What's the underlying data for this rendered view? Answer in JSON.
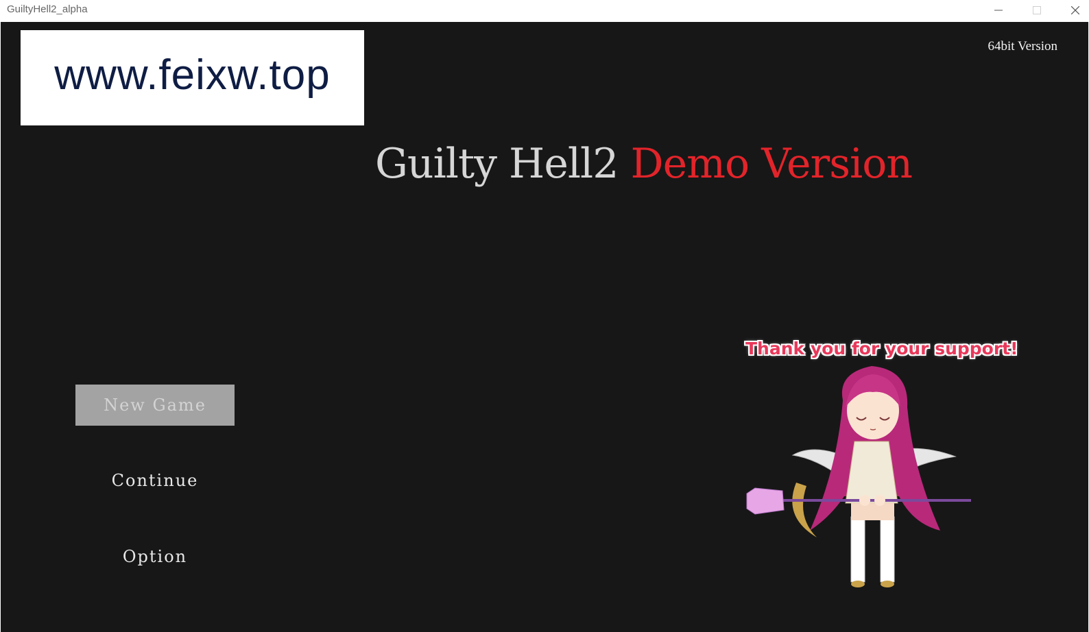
{
  "window": {
    "title": "GuiltyHell2_alpha"
  },
  "logo": {
    "text": "www.feixw.top"
  },
  "version_label": "64bit Version",
  "game_title": {
    "main": "Guilty Hell2",
    "suffix": "Demo Version"
  },
  "menu": {
    "items": [
      {
        "label": "New Game",
        "selected": true
      },
      {
        "label": "Continue",
        "selected": false
      },
      {
        "label": "Option",
        "selected": false
      }
    ]
  },
  "support_message": "Thank you for your support!",
  "colors": {
    "background": "#171717",
    "title_main": "#d6d6d6",
    "title_accent": "#e2242a",
    "menu_selected_bg": "#a3a3a3",
    "support_text": "#e8385a"
  },
  "icons": {
    "minimize": "minimize-icon",
    "maximize": "maximize-icon",
    "close": "close-icon"
  }
}
